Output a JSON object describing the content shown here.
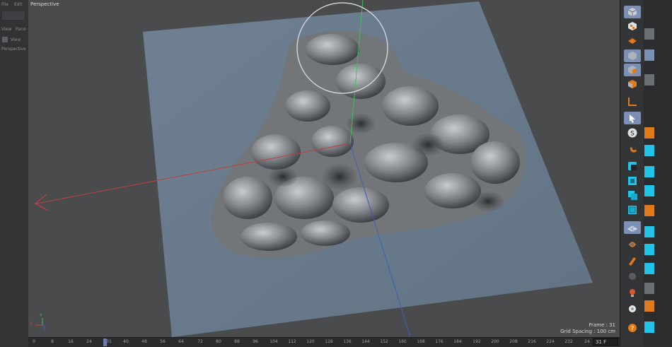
{
  "left_panel": {
    "menu_file": "File",
    "menu_edit": "Edit",
    "row_view": "View",
    "row_pano": "Pano",
    "row_view2": "View",
    "row_perspective": "Perspective"
  },
  "viewport": {
    "label": "Perspective",
    "frame_text": "Frame : 31",
    "grid_spacing_text": "Grid Spacing : 100 cm",
    "axis_y": "Y",
    "axis_x": "X",
    "axis_z": "Z",
    "colors": {
      "background": "#4a4b4d",
      "plane": "#6b7c8c",
      "sculpt": "#6f7378",
      "x_axis": "#c0413b",
      "y_axis": "#3fbf5a",
      "z_axis": "#3a5fb8",
      "brush_circle": "#e6e6e6"
    }
  },
  "timeline": {
    "ticks": [
      "0",
      "8",
      "16",
      "24",
      "31",
      "40",
      "48",
      "56",
      "64",
      "72",
      "80",
      "88",
      "96",
      "104",
      "112",
      "120",
      "128",
      "136",
      "144",
      "152",
      "160",
      "168",
      "176",
      "184",
      "192",
      "200",
      "208",
      "216",
      "224",
      "232",
      "24"
    ],
    "current_frame": "31 F"
  },
  "right_toolbar": {
    "tools": [
      {
        "name": "cube-object-icon",
        "active": true
      },
      {
        "name": "checker-cube-icon",
        "active": false
      },
      {
        "name": "orange-plane-icon",
        "active": false
      },
      {
        "name": "model-mode-icon",
        "active": true
      },
      {
        "name": "object-mode-icon",
        "active": true
      },
      {
        "name": "texture-mode-icon",
        "active": false
      },
      {
        "name": "axis-mode-icon",
        "active": false
      },
      {
        "name": "tweak-mode-icon",
        "active": true
      },
      {
        "name": "solo-icon",
        "active": false
      },
      {
        "name": "magnet-snap-icon",
        "active": false
      },
      {
        "name": "points-mode-icon",
        "active": false
      },
      {
        "name": "edges-mode-icon",
        "active": false
      },
      {
        "name": "polygons-mode-icon",
        "active": false
      },
      {
        "name": "uvw-mode-icon",
        "active": false
      },
      {
        "name": "workplane-icon",
        "active": true
      },
      {
        "name": "lock-workplane-icon",
        "active": false
      },
      {
        "name": "sculpt-brush-icon",
        "active": false
      },
      {
        "name": "paint-icon",
        "active": false
      },
      {
        "name": "light-icon",
        "active": false
      },
      {
        "name": "camera-icon",
        "active": false
      },
      {
        "name": "render-icon",
        "active": false
      }
    ]
  }
}
